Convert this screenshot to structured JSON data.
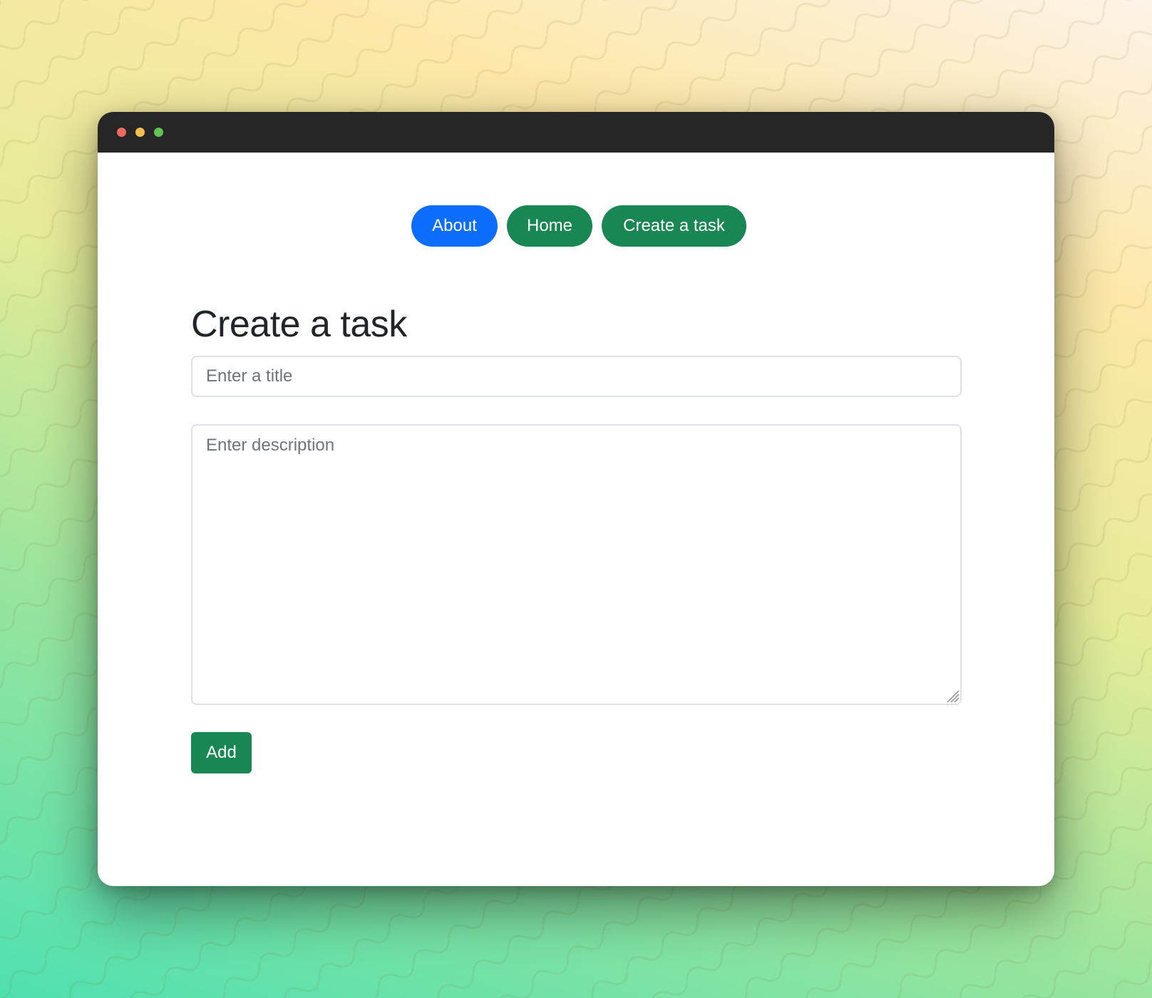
{
  "nav": {
    "about_label": "About",
    "home_label": "Home",
    "create_label": "Create a task"
  },
  "page": {
    "heading": "Create a task"
  },
  "form": {
    "title_placeholder": "Enter a title",
    "title_value": "",
    "description_placeholder": "Enter description",
    "description_value": "",
    "add_label": "Add"
  },
  "colors": {
    "primary": "#0d6efd",
    "success": "#198754",
    "titlebar": "#262626",
    "close_dot": "#ed6a5e",
    "minimize_dot": "#f5bf4f",
    "zoom_dot": "#61c454"
  }
}
